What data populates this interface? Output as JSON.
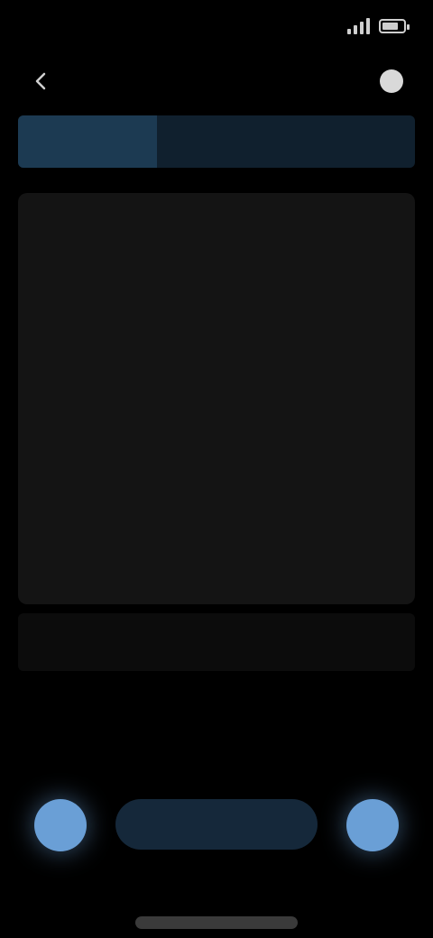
{
  "status_bar": {
    "time": "",
    "battery_level": 0.8
  },
  "header": {
    "title": "",
    "back_icon": "arrow-left-icon",
    "menu_icon": "menu-dot-icon"
  },
  "progress": {
    "fraction": 0.35
  },
  "card": {
    "text": ""
  },
  "controls": {
    "pill_label": "",
    "sub_label": ""
  },
  "colors": {
    "background": "#000000",
    "card": "#141414",
    "accent": "#6a9fd6",
    "progress_track": "#10202e",
    "progress_fill": "#1c3a52",
    "pill": "#15283a"
  }
}
